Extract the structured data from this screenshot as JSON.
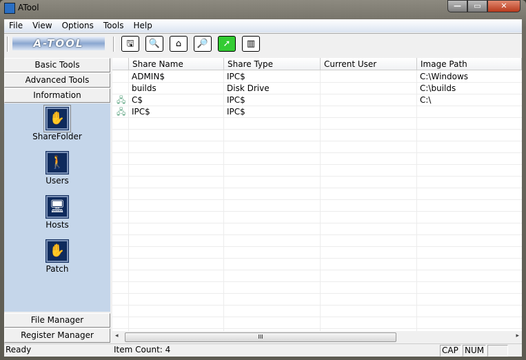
{
  "window": {
    "title": "ATool",
    "min": "—",
    "max": "▭",
    "close": "✕"
  },
  "menu": [
    "File",
    "View",
    "Options",
    "Tools",
    "Help"
  ],
  "toolbar": {
    "logo": "A-TOOL",
    "buttons": [
      "save-icon",
      "search-doc-icon",
      "home-icon",
      "search-icon",
      "export-icon",
      "columns-icon"
    ],
    "glyphs": [
      "🖫",
      "🔍",
      "⌂",
      "🔎",
      "➚",
      "▥"
    ]
  },
  "nav": {
    "top": [
      "Basic Tools",
      "Advanced Tools",
      "Information"
    ],
    "bottom": [
      "File Manager",
      "Register Manager"
    ],
    "items": [
      {
        "label": "ShareFolder",
        "glyph": "✋"
      },
      {
        "label": "Users",
        "glyph": "🚶"
      },
      {
        "label": "Hosts",
        "glyph": "🖥"
      },
      {
        "label": "Patch",
        "glyph": "✋"
      }
    ]
  },
  "table": {
    "columns": [
      "Share Name",
      "Share Type",
      "Current User",
      "Image Path"
    ],
    "rows": [
      [
        "ADMIN$",
        "IPC$",
        "",
        "C:\\Windows"
      ],
      [
        "builds",
        "Disk Drive",
        "",
        "C:\\builds"
      ],
      [
        "C$",
        "IPC$",
        "",
        "C:\\"
      ],
      [
        "IPC$",
        "IPC$",
        "",
        ""
      ]
    ]
  },
  "scroll": {
    "grip": "III",
    "left": "◂",
    "right": "▸"
  },
  "status": {
    "ready": "Ready",
    "count": "Item Count: 4",
    "cap": "CAP",
    "num": "NUM"
  }
}
